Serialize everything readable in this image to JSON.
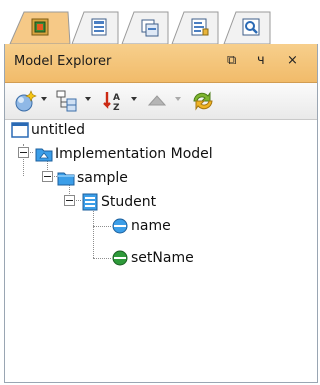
{
  "window": {
    "title": "Model Explorer"
  },
  "title_controls": {
    "restore": "⧉",
    "pin": "ч",
    "close": "×"
  },
  "tabs": [
    {
      "name": "model-explorer-tab",
      "icon": "folder-tree-icon",
      "active": true
    },
    {
      "name": "diagram-navigator-tab",
      "icon": "diagram-icon",
      "active": false
    },
    {
      "name": "class-repository-tab",
      "icon": "repository-icon",
      "active": false
    },
    {
      "name": "property-tab",
      "icon": "property-icon",
      "active": false
    },
    {
      "name": "search-tab",
      "icon": "search-icon",
      "active": false
    }
  ],
  "toolbar": [
    {
      "name": "new-model-element-button",
      "icon": "sparkle-sphere-icon",
      "has_dropdown": true
    },
    {
      "name": "view-options-button",
      "icon": "tree-view-icon",
      "has_dropdown": true
    },
    {
      "name": "sort-button",
      "icon": "sort-az-icon",
      "has_dropdown": true
    },
    {
      "name": "navigate-up-button",
      "icon": "up-arrow-icon",
      "has_dropdown": true,
      "disabled": true
    },
    {
      "name": "refresh-button",
      "icon": "refresh-icon",
      "has_dropdown": false
    }
  ],
  "tree": {
    "root": "untitled",
    "model": "Implementation Model",
    "package": "sample",
    "class": "Student",
    "members": [
      "name",
      "setName"
    ]
  },
  "colors": {
    "header": "#f4c27a",
    "accent": "#2a7fd4",
    "member": "#2e9a3a"
  }
}
